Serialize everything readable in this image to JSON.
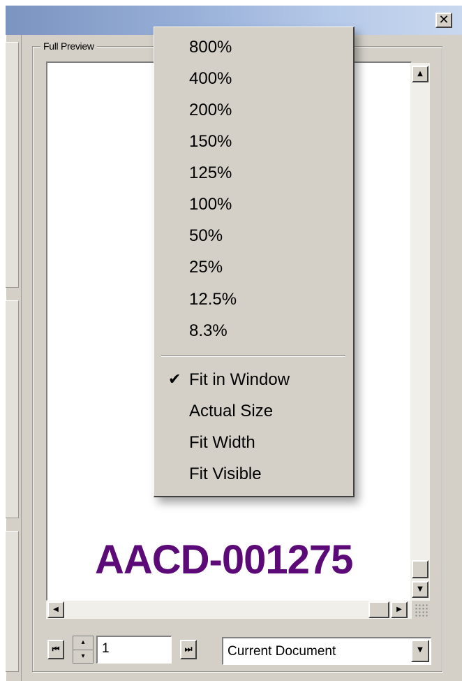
{
  "panel": {
    "group_label": "Full Preview",
    "close_glyph": "✕",
    "document_id": "AACD-001275"
  },
  "zoom_menu": {
    "zoom_levels": [
      "800%",
      "400%",
      "200%",
      "150%",
      "125%",
      "100%",
      "50%",
      "25%",
      "12.5%",
      "8.3%"
    ],
    "fit_options": [
      "Fit in Window",
      "Actual Size",
      "Fit Width",
      "Fit Visible"
    ],
    "checked_option": "Fit in Window",
    "check_glyph": "✔"
  },
  "navigation": {
    "first_page_glyph": "⏮",
    "last_page_glyph": "⏭",
    "spin_up_glyph": "▴",
    "spin_down_glyph": "▾",
    "page_number": "1",
    "document_scope": "Current Document",
    "dropdown_glyph": "▼"
  },
  "scrollbars": {
    "up_glyph": "▲",
    "down_glyph": "▼",
    "left_glyph": "◀",
    "right_glyph": "▶"
  },
  "colors": {
    "document_id_color": "#5c0a78",
    "titlebar_color": "#98b0d8",
    "chrome_color": "#d4d0c8"
  }
}
